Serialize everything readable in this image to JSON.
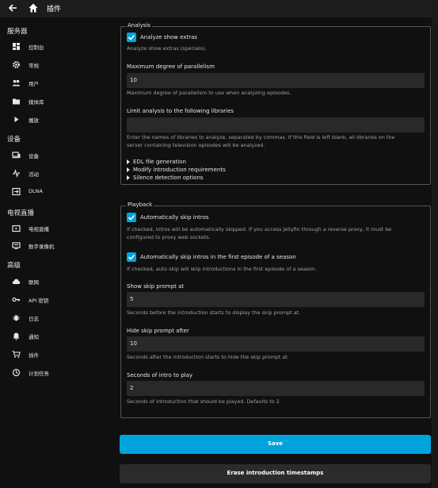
{
  "header": {
    "title": "插件",
    "back_icon": "arrow-left-icon",
    "home_icon": "home-icon"
  },
  "sidebar": {
    "sections": [
      {
        "title": "服务器",
        "items": [
          {
            "label": "控制台",
            "icon": "dashboard-icon"
          },
          {
            "label": "常规",
            "icon": "gear-icon"
          },
          {
            "label": "用户",
            "icon": "users-icon"
          },
          {
            "label": "媒体库",
            "icon": "folder-icon"
          },
          {
            "label": "播放",
            "icon": "play-icon"
          }
        ]
      },
      {
        "title": "设备",
        "items": [
          {
            "label": "设备",
            "icon": "devices-icon"
          },
          {
            "label": "活动",
            "icon": "activity-icon"
          },
          {
            "label": "DLNA",
            "icon": "dlna-icon"
          }
        ]
      },
      {
        "title": "电视直播",
        "items": [
          {
            "label": "电视直播",
            "icon": "live-tv-icon"
          },
          {
            "label": "数字录像机",
            "icon": "dvr-icon"
          }
        ]
      },
      {
        "title": "高级",
        "items": [
          {
            "label": "联网",
            "icon": "cloud-icon"
          },
          {
            "label": "API 密钥",
            "icon": "key-icon"
          },
          {
            "label": "日志",
            "icon": "bug-icon"
          },
          {
            "label": "通知",
            "icon": "bell-icon"
          },
          {
            "label": "插件",
            "icon": "cart-icon"
          },
          {
            "label": "计划任务",
            "icon": "clock-icon"
          }
        ]
      }
    ]
  },
  "analysis": {
    "legend": "Analysis",
    "analyze_show_extras": {
      "label": "Analyze show extras",
      "checked": true,
      "help": "Analyze show extras (specials)."
    },
    "max_parallelism": {
      "label": "Maximum degree of parallelism",
      "value": "10",
      "help": "Maximum degree of parallelism to use when analyzing episodes."
    },
    "limit_libraries": {
      "label": "Limit analysis to the following libraries",
      "value": "",
      "help_line1": "Enter the names of libraries to analyze, separated by commas. If this field is left blank, all libraries on the",
      "help_line2": "server containing television episodes will be analyzed."
    },
    "disclosures": [
      "EDL file generation",
      "Modify introduction requirements",
      "Silence detection options"
    ]
  },
  "playback": {
    "legend": "Playback",
    "auto_skip": {
      "label": "Automatically skip intros",
      "checked": true,
      "help_line1": "If checked, intros will be automatically skipped. If you access Jellyfin through a reverse proxy, it must be",
      "help_line2": "configured to proxy web sockets."
    },
    "auto_skip_first": {
      "label": "Automatically skip intros in the first episode of a season",
      "checked": true,
      "help": "If checked, auto skip will skip introductions in the first episode of a season."
    },
    "show_prompt": {
      "label": "Show skip prompt at",
      "value": "5",
      "help": "Seconds before the introduction starts to display the skip prompt at."
    },
    "hide_prompt": {
      "label": "Hide skip prompt after",
      "value": "10",
      "help": "Seconds after the introduction starts to hide the skip prompt at."
    },
    "intro_seconds": {
      "label": "Seconds of intro to play",
      "value": "2",
      "help": "Seconds of introduction that should be played. Defaults to 2."
    }
  },
  "buttons": {
    "save": "Save",
    "erase": "Erase introduction timestamps"
  },
  "colors": {
    "accent": "#00a4dc",
    "background": "#101010",
    "input_bg": "#292929"
  }
}
